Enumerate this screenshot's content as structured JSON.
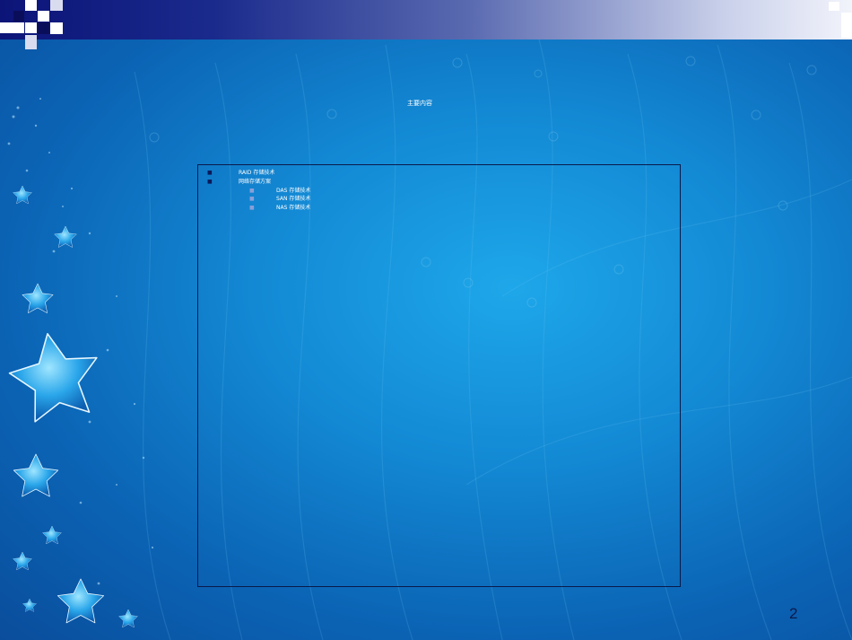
{
  "slide": {
    "title": "主要内容",
    "bullets": [
      {
        "level": 1,
        "text": "RAID 存储技术"
      },
      {
        "level": 1,
        "text": "网络存储方案"
      },
      {
        "level": 2,
        "text": "DAS 存储技术"
      },
      {
        "level": 2,
        "text": "SAN 存储技术"
      },
      {
        "level": 2,
        "text": "NAS 存储技术"
      }
    ],
    "page_number": "2"
  },
  "icons": {
    "decor": "star-icon",
    "bullet_level1": "square-bullet-icon",
    "bullet_level2": "square-bullet-icon"
  },
  "colors": {
    "background": "#1389d4",
    "header_start": "#0c1478",
    "header_end": "#f2f4fb",
    "text": "#ffffff",
    "border": "#0a1a4a"
  }
}
